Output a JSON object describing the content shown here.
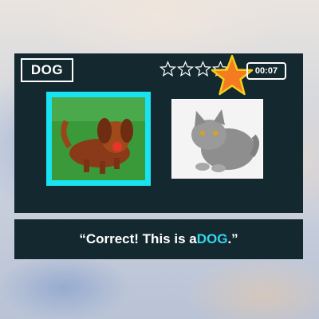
{
  "target": {
    "word": "DOG"
  },
  "rating": {
    "filled": 1,
    "total": 5
  },
  "timer": {
    "value": "00:07"
  },
  "choices": [
    {
      "name": "dog-photo",
      "selected": true
    },
    {
      "name": "cat-photo",
      "selected": false
    }
  ],
  "feedback": {
    "prefix": "“Correct! This is a ",
    "highlight": "DOG",
    "suffix": ".”"
  },
  "colors": {
    "panel": "#14282f",
    "selection": "#19e3f0",
    "highlight_text": "#33d6ee",
    "star_fill": "#f47b20",
    "star_outline": "#f2cf1d"
  },
  "icons": [
    "star-outline-icon",
    "star-filled-icon"
  ]
}
